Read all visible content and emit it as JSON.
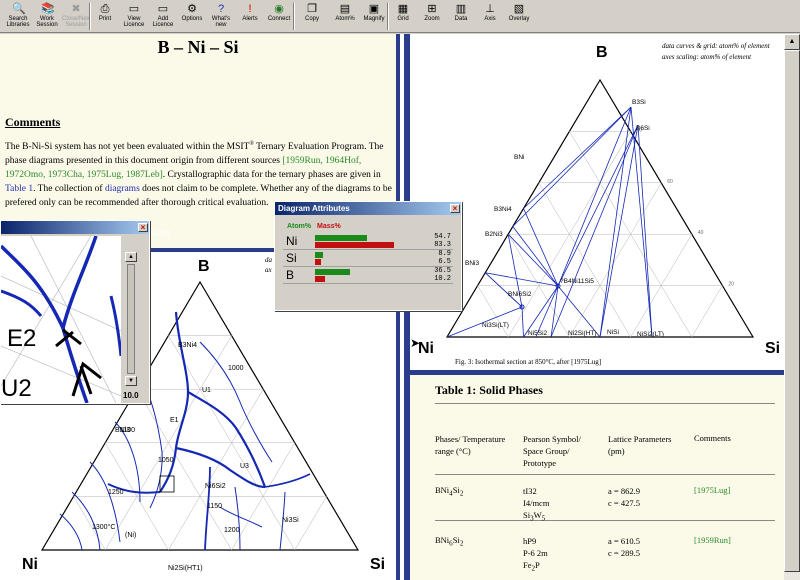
{
  "toolbar": {
    "buttons": [
      {
        "label": "Search Libraries",
        "icon": "search-icon"
      },
      {
        "label": "Work Session",
        "icon": "books-icon"
      },
      {
        "label": "Close/Next Session",
        "icon": "close-session-icon",
        "disabled": true
      },
      {
        "label": "Print",
        "icon": "printer-icon"
      },
      {
        "label": "View Licence",
        "icon": "monitor-icon"
      },
      {
        "label": "Add Licence",
        "icon": "monitor-add-icon"
      },
      {
        "label": "Options",
        "icon": "gear-icon"
      },
      {
        "label": "What's new",
        "icon": "question-icon"
      },
      {
        "label": "Alerts",
        "icon": "alert-icon"
      },
      {
        "label": "Connect",
        "icon": "globe-icon"
      },
      {
        "label": "Copy",
        "icon": "copy-icon"
      },
      {
        "label": "Atom%",
        "icon": "atom-percent-icon"
      },
      {
        "label": "Magnify",
        "icon": "magnify-icon"
      },
      {
        "label": "Grid",
        "icon": "grid-icon"
      },
      {
        "label": "Zoom",
        "icon": "zoom-icon"
      },
      {
        "label": "Data",
        "icon": "data-icon"
      },
      {
        "label": "Axis",
        "icon": "axis-icon"
      },
      {
        "label": "Overlay",
        "icon": "overlay-icon"
      }
    ]
  },
  "comments": {
    "system_title": "B – Ni – Si",
    "heading": "Comments",
    "p1_a": "The B-Ni-Si system has not yet been evaluated within the MSIT",
    "p1_sup": "®",
    "p1_b": " Ternary Evaluation Program. The phase diagrams presented in this document origin from different sources ",
    "p1_refs": "[1959Run, 1964Hof, 1972Omo, 1973Cha, 1975Lug, 1987Leb]",
    "p1_c": ". Crystallographic data for the ternary phases are given in ",
    "p1_table": "Table 1",
    "p1_d": ". The collection of ",
    "p1_diagrams": "diagrams",
    "p1_e": " does not claim to be complete. Whether any of the diagrams to be prefered only can be recommended after thorough critical evaluation."
  },
  "isothermal": {
    "note_line1": "data curves & grid: atom% of element",
    "note_line2": "axes scaling: atom% of element",
    "corner_top": "B",
    "corner_left": "Ni",
    "corner_right": "Si",
    "phase_labels": [
      "B3Si",
      "B6Si",
      "BNi",
      "B3Ni4",
      "B2Ni3",
      "BNi3",
      "?B4Ni11Si5",
      "BNi6Si2",
      "Ni3Si(LT)",
      "Ni5Si2",
      "Ni2Si(HT)",
      "NiSi",
      "NiSi2(LT)"
    ],
    "caption": "Fig. 3: Isothermal section at 850°C, after [1975Lug]",
    "tick_labels": [
      "80",
      "60",
      "40",
      "20"
    ]
  },
  "liquidus": {
    "window_title_fragment": "/Leb]",
    "note": "da ax",
    "corner_top": "B",
    "corner_left": "Ni",
    "corner_right": "Si",
    "labels": [
      "B3Ni4",
      "BNi3",
      "E1",
      "U1",
      "U3",
      "Ni6Si2",
      "Ni3Si",
      "(Ni)",
      "Ni2Si(HT1)",
      "1000",
      "1050",
      "1100",
      "1150",
      "1200",
      "1250",
      "1300°C"
    ]
  },
  "magnifier": {
    "labels": [
      "E2",
      "U2"
    ],
    "zoom_value": "10.0"
  },
  "diagram_attributes": {
    "title": "Diagram Attributes",
    "atom_header": "Atom%",
    "mass_header": "Mass%",
    "atom_color": "#1a8a1a",
    "mass_color": "#c01010",
    "rows": [
      {
        "element": "Ni",
        "atom": "54.7",
        "mass": "83.3",
        "atom_frac": 0.547,
        "mass_frac": 0.833
      },
      {
        "element": "Si",
        "atom": "8.9",
        "mass": "6.5",
        "atom_frac": 0.089,
        "mass_frac": 0.065
      },
      {
        "element": "B",
        "atom": "36.5",
        "mass": "10.2",
        "atom_frac": 0.365,
        "mass_frac": 0.102
      }
    ]
  },
  "table1": {
    "title": "Table 1: Solid Phases",
    "headers": {
      "phase": "Phases/ Temperature range (°C)",
      "pearson": "Pearson Symbol/ Space Group/ Prototype",
      "lattice": "Lattice Parameters (pm)",
      "comments": "Comments"
    },
    "rows": [
      {
        "phase": "BNi4Si2",
        "pearson": [
          "tI32",
          "I4/mcm",
          "Si3W5"
        ],
        "lattice": [
          "a = 862.9",
          "c = 427.5"
        ],
        "ref": "[1975Lug]"
      },
      {
        "phase": "BNi6Si2",
        "pearson": [
          "hP9",
          "P-6 2m",
          "Fe2P"
        ],
        "lattice": [
          "a = 610.5",
          "c = 289.5"
        ],
        "ref": "[1959Run]"
      }
    ]
  },
  "colors": {
    "accent_blue": "#2a3c8c",
    "curve_blue": "#1428b4",
    "link_green": "#2a8a2a",
    "page_bg": "#fbf9e8"
  }
}
